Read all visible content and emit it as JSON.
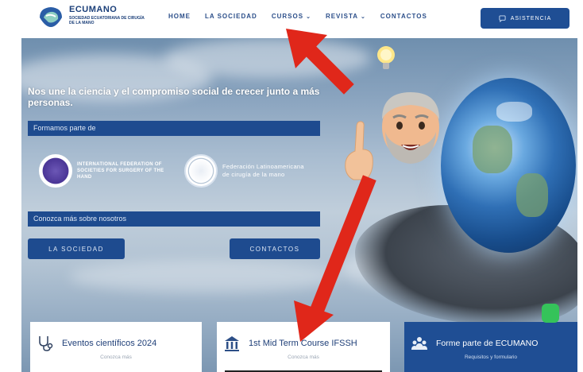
{
  "header": {
    "logo_name": "ECUMANO",
    "logo_sub": "SOCIEDAD ECUATORIANA DE CIRUGÍA DE LA MANO",
    "nav": [
      {
        "label": "HOME",
        "has_dropdown": false
      },
      {
        "label": "LA SOCIEDAD",
        "has_dropdown": false
      },
      {
        "label": "CURSOS",
        "has_dropdown": true
      },
      {
        "label": "REVISTA",
        "has_dropdown": true
      },
      {
        "label": "CONTACTOS",
        "has_dropdown": false
      }
    ],
    "assist_label": "ASISTENCIA",
    "assist_icon": "chat-icon"
  },
  "hero": {
    "tagline": "Nos une la ciencia y el compromiso social de crecer junto a más personas.",
    "partners_bar": "Formamos parte de",
    "partner_1": "INTERNATIONAL FEDERATION OF SOCIETIES FOR SURGERY OF THE HAND",
    "partner_2": "Federación Latinoamericana de cirugía de la mano",
    "about_bar": "Conozca más sobre nosotros",
    "cta_1": "LA SOCIEDAD",
    "cta_2": "CONTACTOS"
  },
  "cards": [
    {
      "title": "Eventos científicos 2024",
      "sub": "Conozca más",
      "icon": "stethoscope-icon"
    },
    {
      "title": "1st Mid Term Course IFSSH",
      "sub": "Conozca más",
      "icon": "institution-icon"
    },
    {
      "title": "Forme parte de ECUMANO",
      "sub": "Requisitos y formulario",
      "icon": "group-icon"
    }
  ],
  "colors": {
    "brand_blue": "#1f4e94",
    "arrow_red": "#e0271a",
    "whatsapp_green": "#35c35a"
  }
}
